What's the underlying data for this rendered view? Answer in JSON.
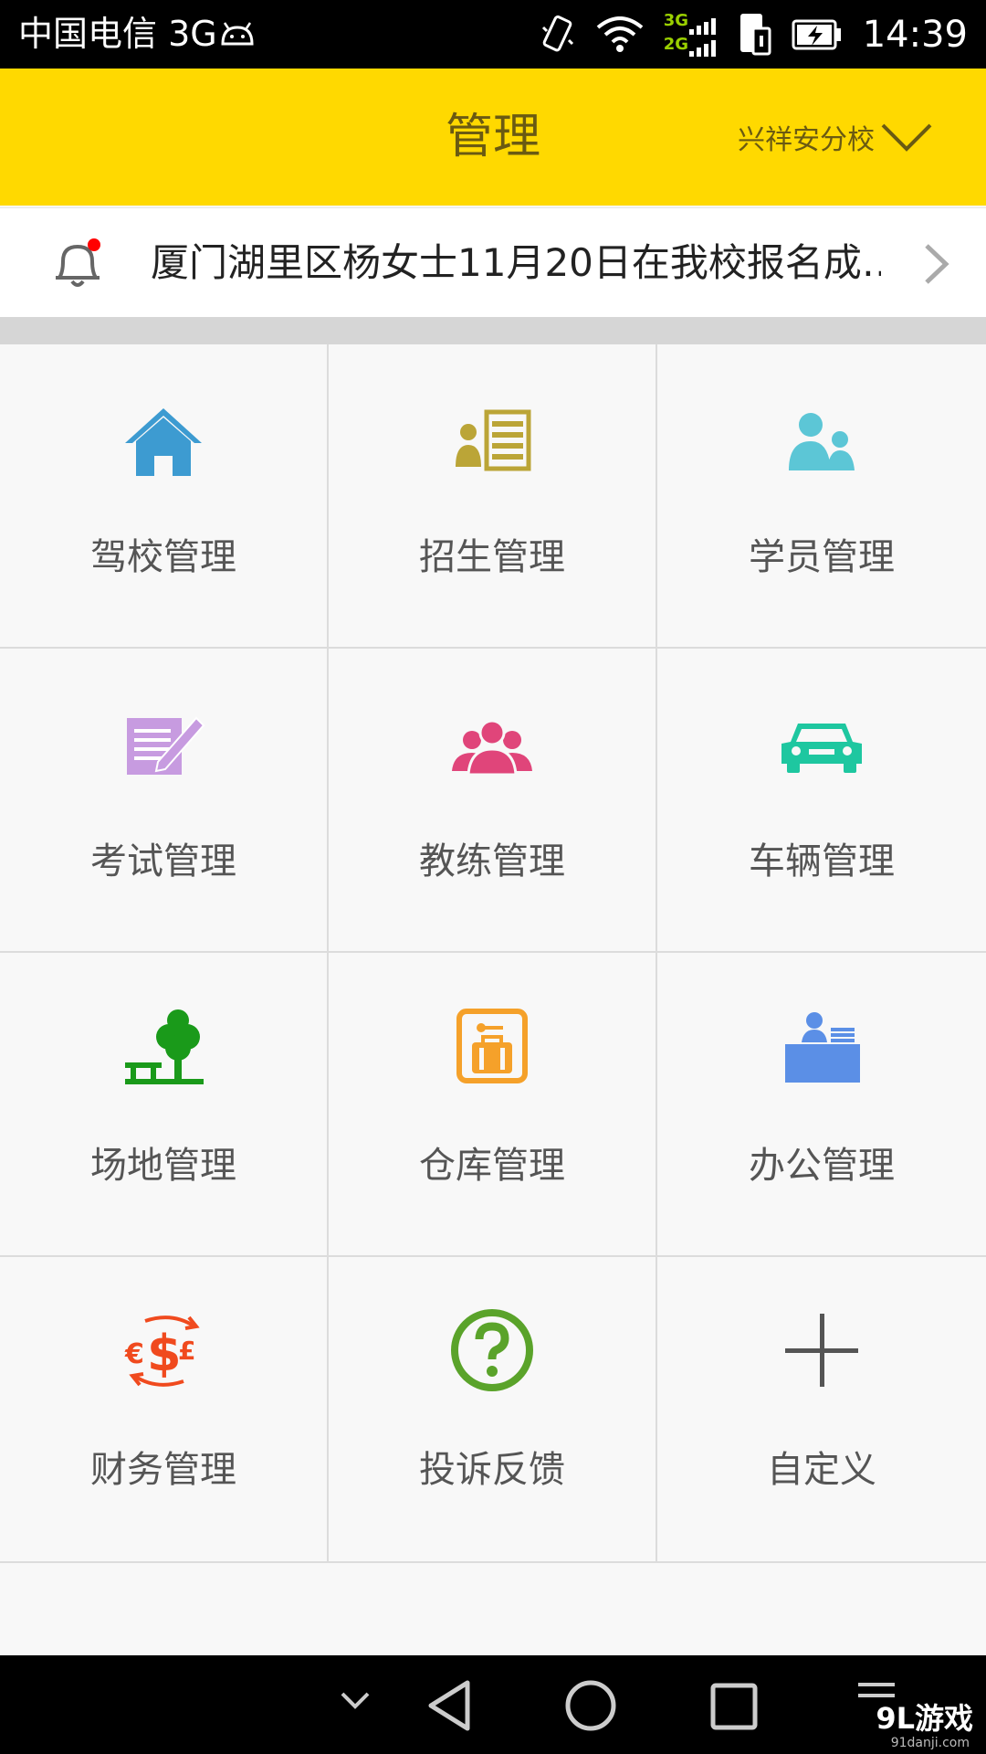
{
  "status_bar": {
    "carrier": "中国电信 3G",
    "network_top": "3G",
    "network_bottom": "2G",
    "time": "14:39"
  },
  "header": {
    "title": "管理",
    "school": "兴祥安分校"
  },
  "notice": {
    "text": "厦门湖里区杨女士11月20日在我校报名成…"
  },
  "grid": {
    "items": [
      {
        "label": "驾校管理",
        "icon": "house-icon",
        "color": "#3d9bd1"
      },
      {
        "label": "招生管理",
        "icon": "enroll-list-icon",
        "color": "#bba537"
      },
      {
        "label": "学员管理",
        "icon": "students-icon",
        "color": "#5cc6d6"
      },
      {
        "label": "考试管理",
        "icon": "exam-pen-icon",
        "color": "#c79be0"
      },
      {
        "label": "教练管理",
        "icon": "coaches-icon",
        "color": "#e0457a"
      },
      {
        "label": "车辆管理",
        "icon": "car-icon",
        "color": "#1ec7a0"
      },
      {
        "label": "场地管理",
        "icon": "tree-field-icon",
        "color": "#1a9a1a"
      },
      {
        "label": "仓库管理",
        "icon": "warehouse-icon",
        "color": "#f5a12a"
      },
      {
        "label": "办公管理",
        "icon": "office-desk-icon",
        "color": "#5b8fe6"
      },
      {
        "label": "财务管理",
        "icon": "currency-icon",
        "color": "#f04a1e"
      },
      {
        "label": "投诉反馈",
        "icon": "question-icon",
        "color": "#5aa32a"
      },
      {
        "label": "自定义",
        "icon": "plus-icon",
        "color": "#555555"
      }
    ]
  },
  "watermark": {
    "brand": "9L游戏",
    "site": "91danji.com"
  },
  "colors": {
    "header_bg": "#ffd900",
    "header_text": "#6a5a12",
    "notice_dot": "#ff0000"
  }
}
